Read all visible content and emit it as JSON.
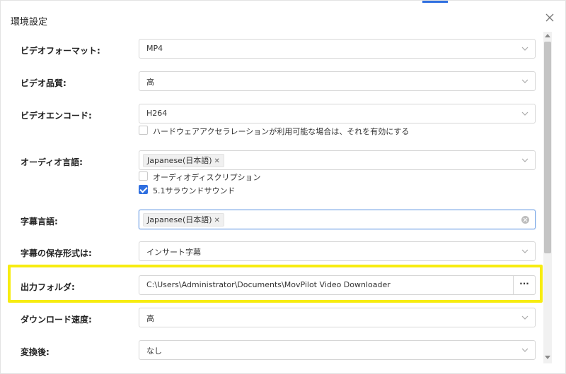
{
  "dialog": {
    "title": "環境設定",
    "close_icon": "close-icon",
    "accent_color": "#2f6fe0",
    "highlight_color": "#f7ec10"
  },
  "settings": {
    "video_format": {
      "label": "ビデオフォーマット:",
      "value": "MP4"
    },
    "video_quality": {
      "label": "ビデオ品質:",
      "value": "高"
    },
    "video_codec": {
      "label": "ビデオエンコード:",
      "value": "H264",
      "hw_accel_label": "ハードウェアアクセラレーションが利用可能な場合は、それを有効にする",
      "hw_accel_checked": false
    },
    "audio_language": {
      "label": "オーディオ言語:",
      "tag": "Japanese(日本語)",
      "audio_description_label": "オーディオディスクリプション",
      "audio_description_checked": false,
      "surround_label": "5.1サラウンドサウンド",
      "surround_checked": true
    },
    "subtitle_language": {
      "label": "字幕言語:",
      "tag": "Japanese(日本語)"
    },
    "subtitle_format": {
      "label": "字幕の保存形式は:",
      "value": "インサート字幕"
    },
    "output_folder": {
      "label": "出力フォルダ:",
      "value": "C:\\Users\\Administrator\\Documents\\MovPilot Video Downloader",
      "browse_label": "···"
    },
    "download_speed": {
      "label": "ダウンロード速度:",
      "value": "高"
    },
    "after_convert": {
      "label": "変換後:",
      "value": "なし"
    }
  }
}
